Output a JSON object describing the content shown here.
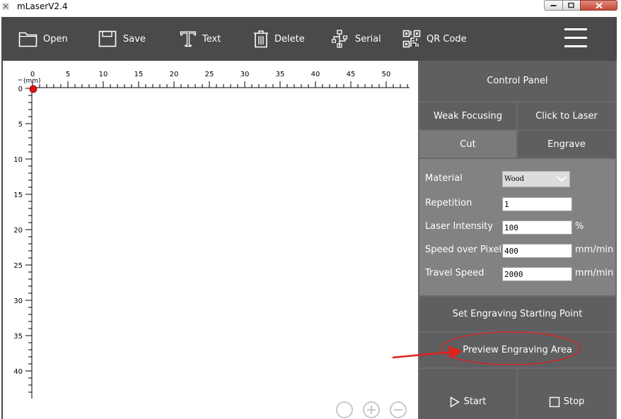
{
  "window": {
    "title": "mLaserV2.4"
  },
  "toolbar": {
    "open": "Open",
    "save": "Save",
    "text": "Text",
    "delete": "Delete",
    "serial": "Serial",
    "qr_code": "QR Code"
  },
  "ruler": {
    "unit": "(mm)",
    "x_labels": [
      "0",
      "5",
      "10",
      "15",
      "20",
      "25",
      "30",
      "35",
      "40",
      "45",
      "50"
    ],
    "y_labels": [
      "0",
      "5",
      "10",
      "15",
      "20",
      "25",
      "30",
      "35",
      "40"
    ]
  },
  "panel": {
    "control_panel": "Control Panel",
    "weak_focusing": "Weak Focusing",
    "click_to_laser": "Click to Laser",
    "cut": "Cut",
    "engrave": "Engrave",
    "material_label": "Material",
    "material_value": "Wood",
    "repetition_label": "Repetition",
    "repetition_value": "1",
    "laser_intensity_label": "Laser Intensity",
    "laser_intensity_value": "100",
    "laser_intensity_unit": "%",
    "speed_label": "Speed over Pixels",
    "speed_value": "400",
    "speed_unit": "mm/min",
    "travel_label": "Travel Speed",
    "travel_value": "2000",
    "travel_unit": "mm/min",
    "set_start": "Set Engraving Starting Point",
    "preview": "Preview Engraving Area",
    "start": "Start",
    "stop": "Stop"
  },
  "colors": {
    "toolbar_bg": "#4a4a4c",
    "annotation_red": "#e0201b",
    "origin_marker": "#e41010"
  }
}
